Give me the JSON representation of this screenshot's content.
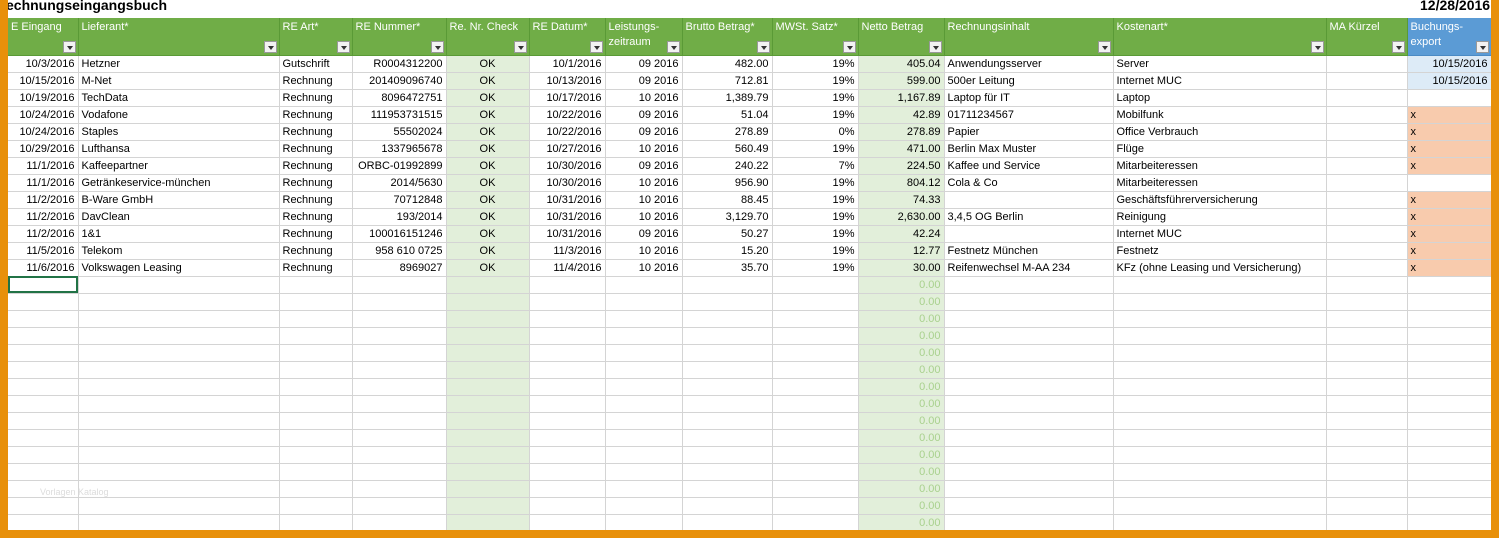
{
  "sheet": {
    "title": "echnungseingangsbuch",
    "date": "12/28/2016"
  },
  "columns": [
    "E Eingang",
    "Lieferant*",
    "RE Art*",
    "RE Nummer*",
    "Re. Nr. Check",
    "RE Datum*",
    "Leistungs-zeitraum",
    "Brutto Betrag*",
    "MWSt. Satz*",
    "Netto Betrag",
    "Rechnungsinhalt",
    "Kostenart*",
    "MA Kürzel",
    "Buchungs-export"
  ],
  "rows": [
    [
      "10/3/2016",
      "Hetzner",
      "Gutschrift",
      "R0004312200",
      "OK",
      "10/1/2016",
      "09 2016",
      "482.00",
      "19%",
      "405.04",
      "Anwendungsserver",
      "Server",
      "",
      "10/15/2016"
    ],
    [
      "10/15/2016",
      "M-Net",
      "Rechnung",
      "201409096740",
      "OK",
      "10/13/2016",
      "09 2016",
      "712.81",
      "19%",
      "599.00",
      "500er Leitung",
      "Internet MUC",
      "",
      "10/15/2016"
    ],
    [
      "10/19/2016",
      "TechData",
      "Rechnung",
      "8096472751",
      "OK",
      "10/17/2016",
      "10 2016",
      "1,389.79",
      "19%",
      "1,167.89",
      "Laptop für IT",
      "Laptop",
      "",
      ""
    ],
    [
      "10/24/2016",
      "Vodafone",
      "Rechnung",
      "111953731515",
      "OK",
      "10/22/2016",
      "09 2016",
      "51.04",
      "19%",
      "42.89",
      "01711234567",
      "Mobilfunk",
      "",
      "x"
    ],
    [
      "10/24/2016",
      "Staples",
      "Rechnung",
      "55502024",
      "OK",
      "10/22/2016",
      "09 2016",
      "278.89",
      "0%",
      "278.89",
      "Papier",
      "Office Verbrauch",
      "",
      "x"
    ],
    [
      "10/29/2016",
      "Lufthansa",
      "Rechnung",
      "1337965678",
      "OK",
      "10/27/2016",
      "10 2016",
      "560.49",
      "19%",
      "471.00",
      "Berlin Max Muster",
      "Flüge",
      "",
      "x"
    ],
    [
      "11/1/2016",
      "Kaffeepartner",
      "Rechnung",
      "ORBC-01992899",
      "OK",
      "10/30/2016",
      "09 2016",
      "240.22",
      "7%",
      "224.50",
      "Kaffee und Service",
      "Mitarbeiteressen",
      "",
      "x"
    ],
    [
      "11/1/2016",
      "Getränkeservice-münchen",
      "Rechnung",
      "2014/5630",
      "OK",
      "10/30/2016",
      "10 2016",
      "956.90",
      "19%",
      "804.12",
      "Cola & Co",
      "Mitarbeiteressen",
      "",
      ""
    ],
    [
      "11/2/2016",
      "B-Ware GmbH",
      "Rechnung",
      "70712848",
      "OK",
      "10/31/2016",
      "10 2016",
      "88.45",
      "19%",
      "74.33",
      "",
      "Geschäftsführerversicherung",
      "",
      "x"
    ],
    [
      "11/2/2016",
      "DavClean",
      "Rechnung",
      "193/2014",
      "OK",
      "10/31/2016",
      "10 2016",
      "3,129.70",
      "19%",
      "2,630.00",
      "3,4,5 OG Berlin",
      "Reinigung",
      "",
      "x"
    ],
    [
      "11/2/2016",
      "1&1",
      "Rechnung",
      "100016151246",
      "OK",
      "10/31/2016",
      "09 2016",
      "50.27",
      "19%",
      "42.24",
      "",
      "Internet MUC",
      "",
      "x"
    ],
    [
      "11/5/2016",
      "Telekom",
      "Rechnung",
      "958 610 0725",
      "OK",
      "11/3/2016",
      "10 2016",
      "15.20",
      "19%",
      "12.77",
      "Festnetz München",
      "Festnetz",
      "",
      "x"
    ],
    [
      "11/6/2016",
      "Volkswagen Leasing",
      "Rechnung",
      "8969027",
      "OK",
      "11/4/2016",
      "10 2016",
      "35.70",
      "19%",
      "30.00",
      "Reifenwechsel M-AA 234",
      "KFz (ohne Leasing und Versicherung)",
      "",
      "x"
    ]
  ],
  "empty_netto_value": "0.00",
  "empty_row_count": 15,
  "watermark": "Vorlagen Katalog",
  "colors": {
    "border": "#e8900a",
    "header": "#70ad47",
    "header_export": "#5b9bd5",
    "check_column": "#e2efda",
    "export_x": "#f8cbad",
    "export_date": "#ddebf7"
  },
  "icons": {
    "filter": "filter-dropdown-icon"
  }
}
